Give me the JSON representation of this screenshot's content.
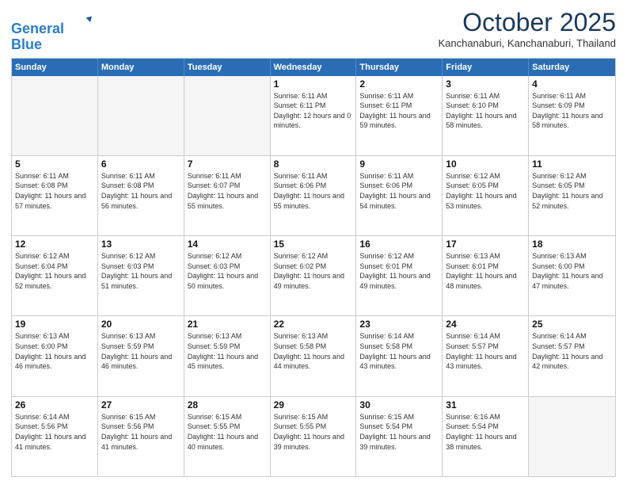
{
  "header": {
    "logo_line1": "General",
    "logo_line2": "Blue",
    "month": "October 2025",
    "location": "Kanchanaburi, Kanchanaburi, Thailand"
  },
  "weekdays": [
    "Sunday",
    "Monday",
    "Tuesday",
    "Wednesday",
    "Thursday",
    "Friday",
    "Saturday"
  ],
  "rows": [
    [
      {
        "empty": true
      },
      {
        "empty": true
      },
      {
        "empty": true
      },
      {
        "day": 1,
        "sunrise": "6:11 AM",
        "sunset": "6:11 PM",
        "daylight": "12 hours and 0 minutes."
      },
      {
        "day": 2,
        "sunrise": "6:11 AM",
        "sunset": "6:11 PM",
        "daylight": "11 hours and 59 minutes."
      },
      {
        "day": 3,
        "sunrise": "6:11 AM",
        "sunset": "6:10 PM",
        "daylight": "11 hours and 58 minutes."
      },
      {
        "day": 4,
        "sunrise": "6:11 AM",
        "sunset": "6:09 PM",
        "daylight": "11 hours and 58 minutes."
      }
    ],
    [
      {
        "day": 5,
        "sunrise": "6:11 AM",
        "sunset": "6:08 PM",
        "daylight": "11 hours and 57 minutes."
      },
      {
        "day": 6,
        "sunrise": "6:11 AM",
        "sunset": "6:08 PM",
        "daylight": "11 hours and 56 minutes."
      },
      {
        "day": 7,
        "sunrise": "6:11 AM",
        "sunset": "6:07 PM",
        "daylight": "11 hours and 55 minutes."
      },
      {
        "day": 8,
        "sunrise": "6:11 AM",
        "sunset": "6:06 PM",
        "daylight": "11 hours and 55 minutes."
      },
      {
        "day": 9,
        "sunrise": "6:11 AM",
        "sunset": "6:06 PM",
        "daylight": "11 hours and 54 minutes."
      },
      {
        "day": 10,
        "sunrise": "6:12 AM",
        "sunset": "6:05 PM",
        "daylight": "11 hours and 53 minutes."
      },
      {
        "day": 11,
        "sunrise": "6:12 AM",
        "sunset": "6:05 PM",
        "daylight": "11 hours and 52 minutes."
      }
    ],
    [
      {
        "day": 12,
        "sunrise": "6:12 AM",
        "sunset": "6:04 PM",
        "daylight": "11 hours and 52 minutes."
      },
      {
        "day": 13,
        "sunrise": "6:12 AM",
        "sunset": "6:03 PM",
        "daylight": "11 hours and 51 minutes."
      },
      {
        "day": 14,
        "sunrise": "6:12 AM",
        "sunset": "6:03 PM",
        "daylight": "11 hours and 50 minutes."
      },
      {
        "day": 15,
        "sunrise": "6:12 AM",
        "sunset": "6:02 PM",
        "daylight": "11 hours and 49 minutes."
      },
      {
        "day": 16,
        "sunrise": "6:12 AM",
        "sunset": "6:01 PM",
        "daylight": "11 hours and 49 minutes."
      },
      {
        "day": 17,
        "sunrise": "6:13 AM",
        "sunset": "6:01 PM",
        "daylight": "11 hours and 48 minutes."
      },
      {
        "day": 18,
        "sunrise": "6:13 AM",
        "sunset": "6:00 PM",
        "daylight": "11 hours and 47 minutes."
      }
    ],
    [
      {
        "day": 19,
        "sunrise": "6:13 AM",
        "sunset": "6:00 PM",
        "daylight": "11 hours and 46 minutes."
      },
      {
        "day": 20,
        "sunrise": "6:13 AM",
        "sunset": "5:59 PM",
        "daylight": "11 hours and 46 minutes."
      },
      {
        "day": 21,
        "sunrise": "6:13 AM",
        "sunset": "5:59 PM",
        "daylight": "11 hours and 45 minutes."
      },
      {
        "day": 22,
        "sunrise": "6:13 AM",
        "sunset": "5:58 PM",
        "daylight": "11 hours and 44 minutes."
      },
      {
        "day": 23,
        "sunrise": "6:14 AM",
        "sunset": "5:58 PM",
        "daylight": "11 hours and 43 minutes."
      },
      {
        "day": 24,
        "sunrise": "6:14 AM",
        "sunset": "5:57 PM",
        "daylight": "11 hours and 43 minutes."
      },
      {
        "day": 25,
        "sunrise": "6:14 AM",
        "sunset": "5:57 PM",
        "daylight": "11 hours and 42 minutes."
      }
    ],
    [
      {
        "day": 26,
        "sunrise": "6:14 AM",
        "sunset": "5:56 PM",
        "daylight": "11 hours and 41 minutes."
      },
      {
        "day": 27,
        "sunrise": "6:15 AM",
        "sunset": "5:56 PM",
        "daylight": "11 hours and 41 minutes."
      },
      {
        "day": 28,
        "sunrise": "6:15 AM",
        "sunset": "5:55 PM",
        "daylight": "11 hours and 40 minutes."
      },
      {
        "day": 29,
        "sunrise": "6:15 AM",
        "sunset": "5:55 PM",
        "daylight": "11 hours and 39 minutes."
      },
      {
        "day": 30,
        "sunrise": "6:15 AM",
        "sunset": "5:54 PM",
        "daylight": "11 hours and 39 minutes."
      },
      {
        "day": 31,
        "sunrise": "6:16 AM",
        "sunset": "5:54 PM",
        "daylight": "11 hours and 38 minutes."
      },
      {
        "empty": true
      }
    ]
  ]
}
